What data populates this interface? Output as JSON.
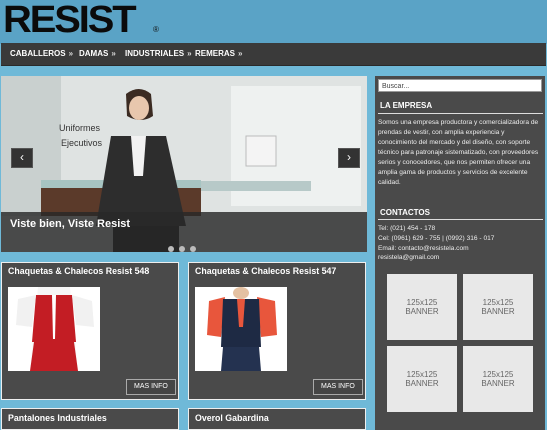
{
  "logo": {
    "text": "RESIST",
    "reg": "®"
  },
  "nav": {
    "items": [
      {
        "label": "CABALLEROS",
        "arrow": "»"
      },
      {
        "label": "DAMAS",
        "arrow": "»"
      },
      {
        "label": "INDUSTRIALES",
        "arrow": "»"
      },
      {
        "label": "REMERAS",
        "arrow": "»"
      }
    ]
  },
  "slider": {
    "caption": "Viste bien, Viste Resist",
    "poster_text_1": "Uniformes",
    "poster_text_2": "Ejecutivos",
    "prev": "‹",
    "next": "›"
  },
  "sidebar": {
    "search_placeholder": "Buscar...",
    "company_title": "LA EMPRESA",
    "company_text": "Somos una empresa productora y comercializadora de prendas de vestir, con amplia experiencia y conocimiento del mercado y del diseño, con soporte técnico para patronaje sistematizado, con proveedores serios y conocedores, que nos permiten ofrecer una amplia gama de productos y servicios de excelente calidad.",
    "contacts_title": "CONTACTOS",
    "contact_lines": [
      "Tel: (021) 454 - 178",
      "Cel: (0961) 629 - 755 | (0992) 316 - 017",
      "Email: contacto@resistela.com",
      "resistela@gmail.com"
    ],
    "banners": [
      {
        "size": "125x125",
        "label": "BANNER"
      },
      {
        "size": "125x125",
        "label": "BANNER"
      },
      {
        "size": "125x125",
        "label": "BANNER"
      },
      {
        "size": "125x125",
        "label": "BANNER"
      }
    ]
  },
  "products": [
    {
      "title": "Chaquetas & Chalecos Resist 548",
      "button": "MAS INFO"
    },
    {
      "title": "Chaquetas & Chalecos Resist 547",
      "button": "MAS INFO"
    },
    {
      "title": "Pantalones Industriales"
    },
    {
      "title": "Overol Gabardina"
    }
  ],
  "colors": {
    "accent": "#5aa3c6",
    "panel": "#4a4a4a",
    "nav": "#3a3a3a"
  }
}
